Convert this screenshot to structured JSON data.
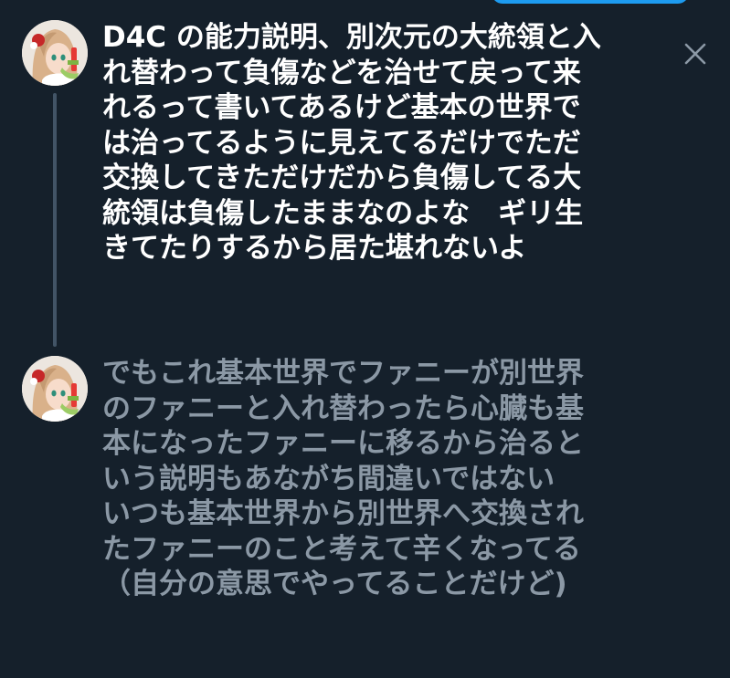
{
  "thread": {
    "close_label": "×",
    "replies": [
      {
        "text": "D4C の能力説明、別次元の大統領と入\nれ替わって負傷などを治せて戻って来\nれるって書いてあるけど基本の世界で\nは治ってるように見えてるだけでただ\n交換してきただけだから負傷してる大\n統領は負傷したままなのよな　ギリ生\nきてたりするから居た堪れないよ",
        "color": "#ffffff"
      },
      {
        "text": "でもこれ基本世界でファニーが別世界\nのファニーと入れ替わったら心臓も基\n本になったファニーに移るから治ると\nいう説明もあながち間違いではない\nいつも基本世界から別世界へ交換され\nたファニーのこと考えて辛くなってる\n（自分の意思でやってることだけど)",
        "color": "#8b98a5"
      }
    ]
  },
  "colors": {
    "background": "#15202b",
    "thread_line": "#425466",
    "accent": "#1d9bf0",
    "close_icon": "#8b98a5"
  }
}
